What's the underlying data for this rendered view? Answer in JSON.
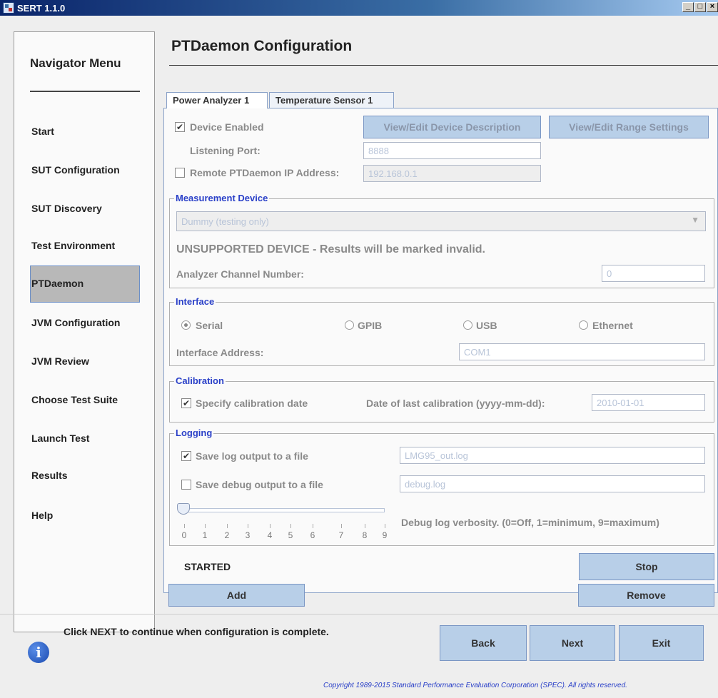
{
  "window": {
    "title": "SERT 1.1.0",
    "buttons": [
      "_",
      "□",
      "×"
    ]
  },
  "nav": {
    "title": "Navigator Menu",
    "items": [
      {
        "label": "Start",
        "selected": false
      },
      {
        "label": "SUT Configuration",
        "selected": false
      },
      {
        "label": "SUT Discovery",
        "selected": false
      },
      {
        "label": "Test Environment",
        "selected": false
      },
      {
        "label": "PTDaemon",
        "selected": true
      },
      {
        "label": "JVM Configuration",
        "selected": false
      },
      {
        "label": "JVM Review",
        "selected": false
      },
      {
        "label": "Choose Test Suite",
        "selected": false
      },
      {
        "label": "Launch Test",
        "selected": false
      },
      {
        "label": "Results",
        "selected": false
      },
      {
        "label": "Help",
        "selected": false
      }
    ]
  },
  "main": {
    "title": "PTDaemon Configuration",
    "tabs": [
      {
        "label": "Power Analyzer 1",
        "active": true
      },
      {
        "label": "Temperature Sensor 1",
        "active": false
      }
    ],
    "device_enabled": {
      "label": "Device Enabled",
      "checked": true
    },
    "view_edit_description": "View/Edit Device Description",
    "view_edit_range": "View/Edit Range Settings",
    "listening_port": {
      "label": "Listening Port:",
      "value": "8888"
    },
    "remote_ip": {
      "label": "Remote PTDaemon IP Address:",
      "value": "192.168.0.1",
      "checked": false
    },
    "measurement": {
      "group_label": "Measurement Device",
      "device": "Dummy (testing only)",
      "warning": "UNSUPPORTED DEVICE - Results will be marked invalid.",
      "channel_label": "Analyzer Channel Number:",
      "channel_value": "0"
    },
    "interface": {
      "group_label": "Interface",
      "options": [
        "Serial",
        "GPIB",
        "USB",
        "Ethernet"
      ],
      "selected": "Serial",
      "address_label": "Interface Address:",
      "address_value": "COM1"
    },
    "calibration": {
      "group_label": "Calibration",
      "specify_label": "Specify calibration date",
      "checked": true,
      "date_label": "Date of last calibration (yyyy-mm-dd):",
      "date_value": "2010-01-01"
    },
    "logging": {
      "group_label": "Logging",
      "save_log_label": "Save log output to a file",
      "save_log_checked": true,
      "log_file": "LMG95_out.log",
      "save_debug_label": "Save debug output to a file",
      "save_debug_checked": false,
      "debug_file": "debug.log",
      "verbosity_ticks": [
        "0",
        "1",
        "2",
        "3",
        "4",
        "5",
        "6",
        "7",
        "8",
        "9"
      ],
      "verbosity_value": 0,
      "verbosity_label": "Debug log verbosity. (0=Off, 1=minimum, 9=maximum)"
    },
    "status": "STARTED",
    "stop_label": "Stop",
    "add_label": "Add",
    "remove_label": "Remove"
  },
  "footer": {
    "hint": "Click NEXT to continue when configuration is complete.",
    "back": "Back",
    "next": "Next",
    "exit": "Exit",
    "copyright": "Copyright 1989-2015 Standard Performance Evaluation Corporation (SPEC). All rights reserved.",
    "info_glyph": "i"
  },
  "colors": {
    "accent": "#2a40c8",
    "button": "#b8cfe8",
    "selected_nav": "#b8b8b8"
  }
}
